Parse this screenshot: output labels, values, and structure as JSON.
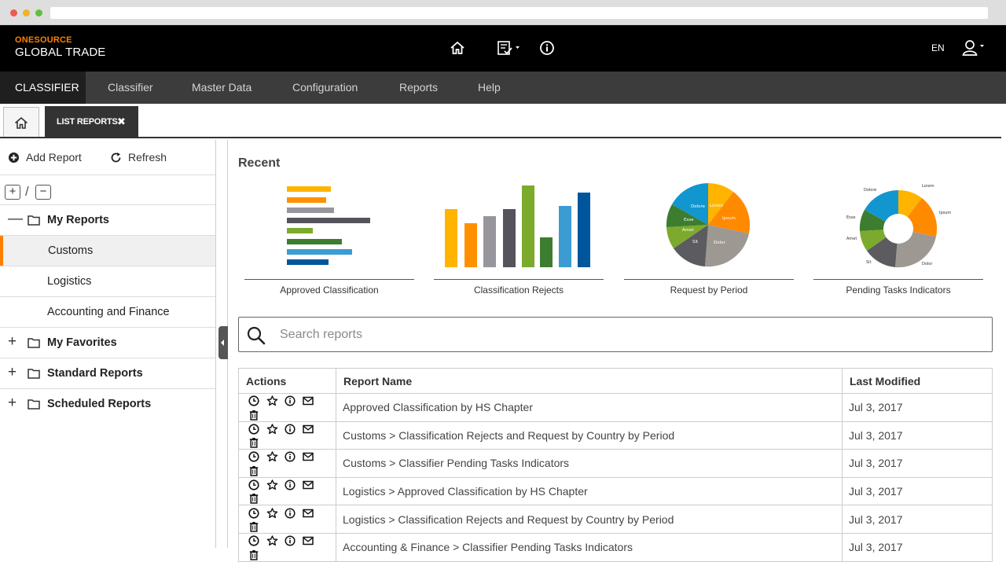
{
  "colors": {
    "accent": "#ff8000",
    "header_bg": "#000000",
    "nav_bg": "#3c3c3c",
    "nav_active_bg": "#1f1f1f"
  },
  "header": {
    "brand_top": "ONESOURCE",
    "brand_main": "GLOBAL TRADE",
    "icons": [
      "home-icon",
      "task-list-icon",
      "info-icon",
      "user-icon"
    ],
    "language": "EN"
  },
  "nav": {
    "items": [
      {
        "label": "CLASSIFIER",
        "active": true
      },
      {
        "label": "Classifier"
      },
      {
        "label": "Master Data"
      },
      {
        "label": "Configuration"
      },
      {
        "label": "Reports"
      },
      {
        "label": "Help"
      }
    ]
  },
  "tabs": {
    "active_label": "LIST REPORTS",
    "close_glyph": "✖"
  },
  "sidebar": {
    "add_label": "Add Report",
    "refresh_label": "Refresh",
    "expand_label": "+",
    "collapse_label": "−",
    "separator": "/",
    "tree": [
      {
        "label": "My Reports",
        "toggle": "—",
        "type": "folder"
      },
      {
        "label": "Customs",
        "type": "child",
        "selected": true
      },
      {
        "label": "Logistics",
        "type": "child"
      },
      {
        "label": "Accounting and Finance",
        "type": "child"
      },
      {
        "label": "My Favorites",
        "toggle": "+",
        "type": "folder"
      },
      {
        "label": "Standard Reports",
        "toggle": "+",
        "type": "folder"
      },
      {
        "label": "Scheduled Reports",
        "toggle": "+",
        "type": "folder"
      }
    ]
  },
  "recent": {
    "title": "Recent",
    "cards": [
      {
        "caption": "Approved Classification",
        "chart": "horizontal-bar-thumbnail"
      },
      {
        "caption": "Classification Rejects",
        "chart": "vertical-bar-thumbnail"
      },
      {
        "caption": "Request by Period",
        "chart": "pie-thumbnail"
      },
      {
        "caption": "Pending Tasks Indicators",
        "chart": "donut-thumbnail"
      }
    ],
    "pie_labels": [
      "Lorem",
      "Ipsum",
      "Dolor",
      "Sit",
      "Amet",
      "Esse",
      "Dolore"
    ]
  },
  "search": {
    "placeholder": "Search reports"
  },
  "table": {
    "columns": [
      "Actions",
      "Report Name",
      "Last Modified"
    ],
    "action_icons": [
      "clock-icon",
      "star-icon",
      "info-icon",
      "mail-icon",
      "trash-icon"
    ],
    "rows": [
      {
        "name": "Approved Classification by HS Chapter",
        "modified": "Jul 3, 2017"
      },
      {
        "name": "Customs > Classification Rejects and Request by Country by Period",
        "modified": "Jul 3, 2017"
      },
      {
        "name": "Customs > Classifier Pending Tasks Indicators",
        "modified": "Jul 3, 2017"
      },
      {
        "name": "Logistics > Approved Classification by HS Chapter",
        "modified": "Jul 3, 2017"
      },
      {
        "name": "Logistics > Classification Rejects and Request by Country by Period",
        "modified": "Jul 3, 2017"
      },
      {
        "name": "Accounting & Finance > Classifier Pending Tasks Indicators",
        "modified": "Jul 3, 2017"
      }
    ]
  }
}
